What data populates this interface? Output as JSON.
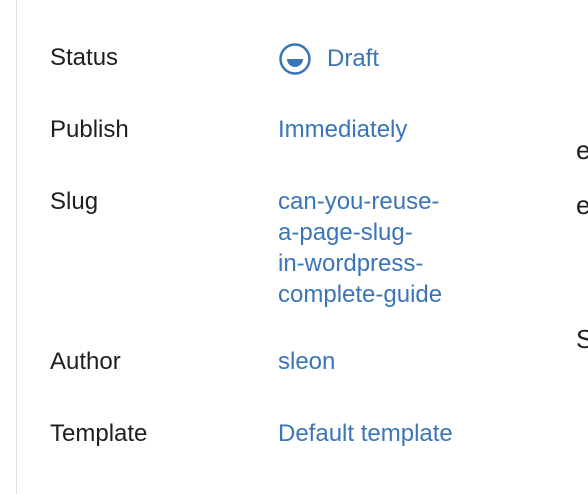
{
  "summary": {
    "rows": {
      "status": {
        "label": "Status",
        "value": "Draft",
        "icon": "draft-status-icon"
      },
      "publish": {
        "label": "Publish",
        "value": "Immediately"
      },
      "slug": {
        "label": "Slug",
        "value_lines": [
          "can-you-reuse-",
          "a-page-slug-",
          "in-wordpress-",
          "complete-guide"
        ]
      },
      "author": {
        "label": "Author",
        "value": "sleon"
      },
      "template": {
        "label": "Template",
        "value": "Default template"
      }
    }
  },
  "colors": {
    "label_text": "#1e1e1e",
    "link": "#3a75b8",
    "divider": "#e0e0e0"
  },
  "right_edge_fragments": [
    "er",
    "e",
    "S"
  ]
}
